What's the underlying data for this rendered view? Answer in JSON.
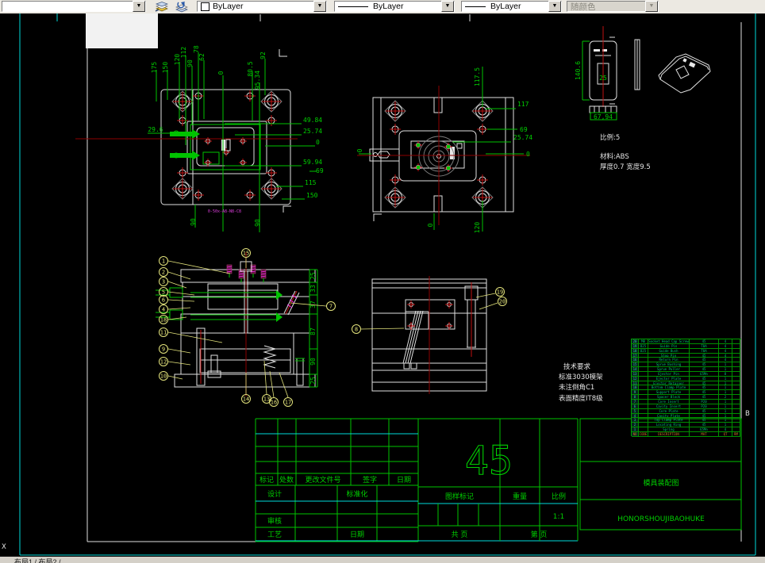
{
  "toolbar": {
    "color_value": "ByLayer",
    "linetype_value": "ByLayer",
    "lineweight_value": "ByLayer",
    "plotstyle_value": "随颜色"
  },
  "colors": {
    "dimension_green": "#00ce00",
    "centerline_red": "#c01010",
    "balloon_yellow": "#e4e47c",
    "viewport_cyan": "#00dada",
    "hatch_magenta": "#ff30ff"
  },
  "status": {
    "layout_tabs": "布局1 / 布局2 /"
  },
  "labels": {
    "view_letter": "B",
    "ucs_x": "X"
  },
  "plan_view": {
    "top_dims": [
      "175",
      "150",
      "120",
      "112",
      "90",
      "78",
      "62",
      "0"
    ],
    "right_top_dims": [
      "92",
      "80.5",
      "95.34"
    ],
    "left_dim": "29.6",
    "right_dims": [
      "49.84",
      "25.74",
      "0",
      "59.94",
      "69",
      "115",
      "150"
    ],
    "bottom_dims": [
      "90",
      "90"
    ],
    "magenta_note": "0-50x-A8-N8-C8"
  },
  "front_view": {
    "top_dim": "117.5",
    "right_dims": [
      "117",
      "69",
      "25.74",
      "0"
    ],
    "left_dim": "0",
    "bottom_dims": [
      "0",
      "120"
    ]
  },
  "part_views": {
    "height_dim": "140.6",
    "width_dim": "67,94",
    "inner_dim": "25",
    "scale_note": "比例:5",
    "material_note": "材料:ABS",
    "size_note": "厚度0.7 宽度9.5"
  },
  "section_a": {
    "right_dims": [
      "25",
      "33",
      "37",
      "87",
      "90",
      "25"
    ]
  },
  "balloons": [
    "1",
    "2",
    "3",
    "5",
    "6",
    "4",
    "18",
    "11",
    "9",
    "12",
    "10",
    "15",
    "7",
    "14",
    "13",
    "16",
    "17",
    "8",
    "19",
    "20"
  ],
  "tech_notes": [
    "技术要求",
    "标准3030模架",
    "未注倒角C1",
    "表面精度IT8级"
  ],
  "bom": {
    "header": [
      "NO",
      "CODE",
      "DESCRIPTION",
      "MAT",
      "QT",
      "RM"
    ],
    "rows": [
      [
        "20",
        "M8",
        "Socket Head Cap Screw",
        "45",
        "4",
        ""
      ],
      [
        "19",
        "D25",
        "Guide Pin",
        "T8A",
        "4",
        ""
      ],
      [
        "18",
        "D25",
        "Guide Bush",
        "T8A",
        "4",
        ""
      ],
      [
        "17",
        "",
        "Stop Pin",
        "45",
        "4",
        ""
      ],
      [
        "16",
        "",
        "Return Pin",
        "45",
        "4",
        ""
      ],
      [
        "15",
        "",
        "Sprue Bushing",
        "45",
        "1",
        ""
      ],
      [
        "14",
        "",
        "Sprue Puller",
        "45",
        "1",
        ""
      ],
      [
        "13",
        "",
        "Ejector Pin",
        "65Mn",
        "8",
        ""
      ],
      [
        "12",
        "",
        "Ejector Plate",
        "45",
        "1",
        ""
      ],
      [
        "11",
        "",
        "Ejector Retainer",
        "45",
        "1",
        ""
      ],
      [
        "10",
        "",
        "Bottom Clamp Plate",
        "45",
        "1",
        ""
      ],
      [
        "9",
        "",
        "Support Plate",
        "45",
        "1",
        ""
      ],
      [
        "8",
        "",
        "Spacer Block",
        "45",
        "2",
        ""
      ],
      [
        "7",
        "",
        "Core Insert",
        "P20",
        "1",
        ""
      ],
      [
        "6",
        "",
        "Cavity Insert",
        "P20",
        "1",
        ""
      ],
      [
        "5",
        "",
        "Core Plate",
        "45",
        "1",
        ""
      ],
      [
        "4",
        "",
        "Cavity Plate",
        "45",
        "1",
        ""
      ],
      [
        "3",
        "",
        "Top Clamp Plate",
        "45",
        "1",
        ""
      ],
      [
        "2",
        "",
        "Locating Ring",
        "45",
        "1",
        ""
      ],
      [
        "1",
        "",
        "Spring",
        "65Mn",
        "4",
        ""
      ]
    ]
  },
  "title_block": {
    "material_mark": "45",
    "rev_headers": [
      "标记",
      "处数",
      "更改文件号",
      "签字",
      "日期"
    ],
    "role_design": "设计",
    "role_standard": "标准化",
    "role_check": "审核",
    "role_process": "工艺",
    "role_date": "日期",
    "stamp_headers": [
      "图样标记",
      "重量",
      "比例"
    ],
    "scale_value": "1:1",
    "sheet_left": "共  页",
    "sheet_right": "第  页",
    "drawing_title": "模具装配图",
    "company": "HONORSHOUJIBAOHUKE"
  }
}
